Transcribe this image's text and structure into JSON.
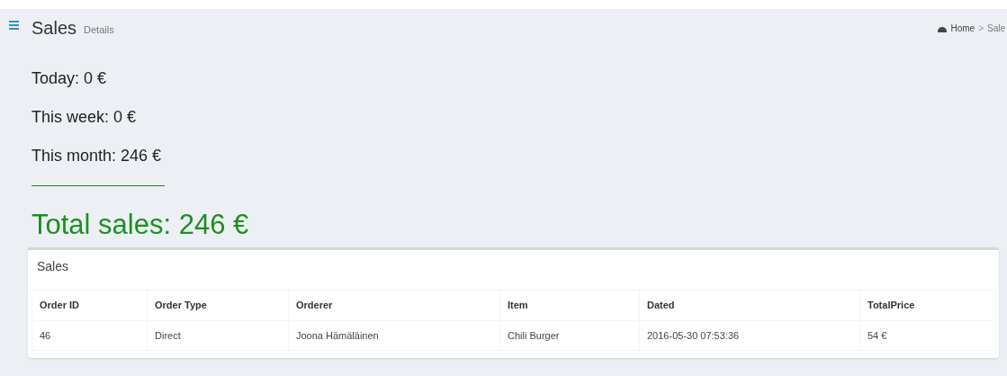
{
  "header": {
    "title": "Sales",
    "subtitle": "Details"
  },
  "breadcrumb": [
    {
      "label": "Home",
      "kind": "home"
    },
    {
      "label": ">",
      "kind": "separator"
    },
    {
      "label": "Sale",
      "kind": "page"
    }
  ],
  "summary": [
    "Today: 0 €",
    "This week: 0 €",
    "This month: 246 €"
  ],
  "total": "Total sales: 246 €",
  "table": {
    "title": "Sales",
    "columns": [
      "Order ID",
      "Order Type",
      "Orderer",
      "Item",
      "Dated",
      "TotalPrice"
    ],
    "rows": [
      [
        "46",
        "Direct",
        "Joona Hämäläinen",
        "Chili Burger",
        "2016-05-30 07:53:36",
        "54 €"
      ]
    ]
  }
}
